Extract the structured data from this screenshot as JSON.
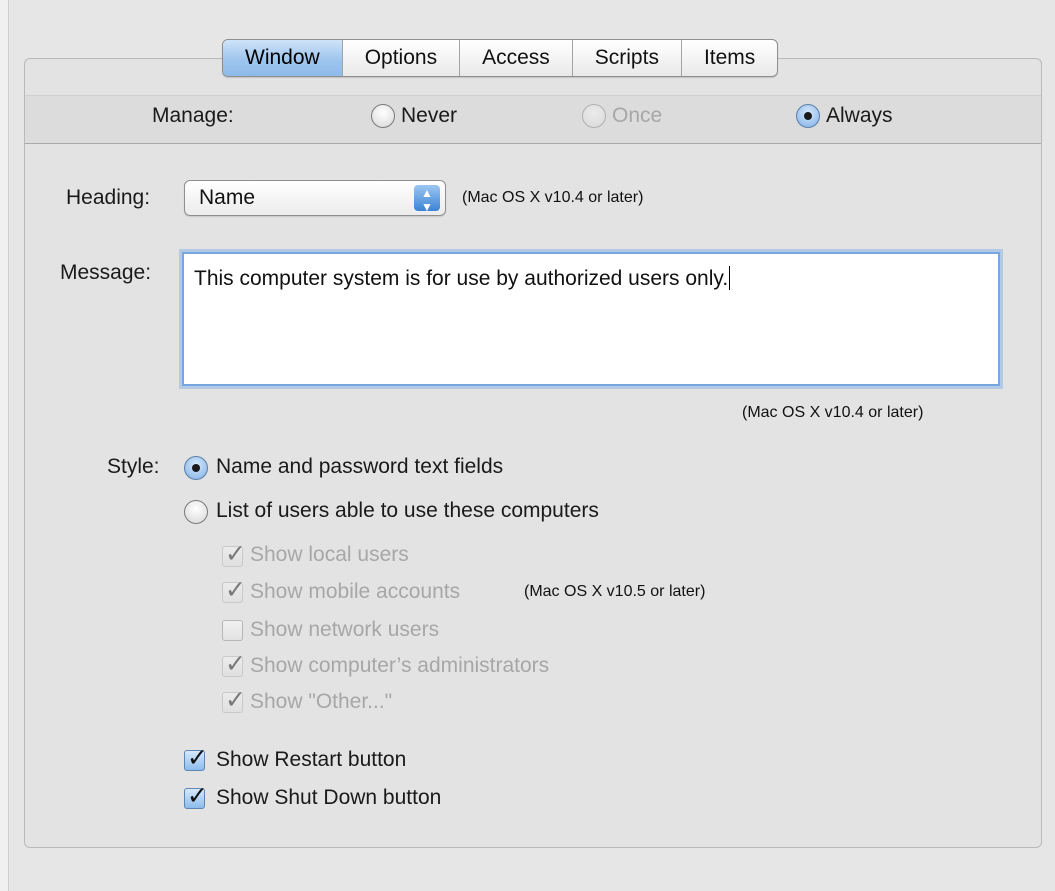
{
  "tabs": [
    "Window",
    "Options",
    "Access",
    "Scripts",
    "Items"
  ],
  "active_tab": "Window",
  "manage": {
    "label": "Manage:",
    "options": [
      {
        "label": "Never",
        "selected": false,
        "enabled": true
      },
      {
        "label": "Once",
        "selected": false,
        "enabled": false
      },
      {
        "label": "Always",
        "selected": true,
        "enabled": true
      }
    ]
  },
  "heading": {
    "label": "Heading:",
    "value": "Name",
    "note": "(Mac OS X v10.4 or later)"
  },
  "message": {
    "label": "Message:",
    "value": "This computer system is for use by authorized users only.",
    "note": "(Mac OS X v10.4 or later)"
  },
  "style": {
    "label": "Style:",
    "options": [
      {
        "label": "Name and password text fields",
        "selected": true
      },
      {
        "label": "List of users able to use these computers",
        "selected": false
      }
    ],
    "suboptions": [
      {
        "label": "Show local users",
        "checked": true,
        "enabled": false
      },
      {
        "label": "Show mobile accounts",
        "checked": true,
        "enabled": false,
        "note": "(Mac OS X v10.5 or later)"
      },
      {
        "label": "Show network users",
        "checked": false,
        "enabled": false
      },
      {
        "label": "Show computer’s administrators",
        "checked": true,
        "enabled": false
      },
      {
        "label": "Show \"Other...\"",
        "checked": true,
        "enabled": false
      }
    ]
  },
  "buttons_options": [
    {
      "label": "Show Restart button",
      "checked": true
    },
    {
      "label": "Show Shut Down button",
      "checked": true
    }
  ],
  "colors": {
    "accent": "#7fb0e6",
    "panel": "#e3e3e3",
    "disabled_text": "#a7a7a7"
  }
}
